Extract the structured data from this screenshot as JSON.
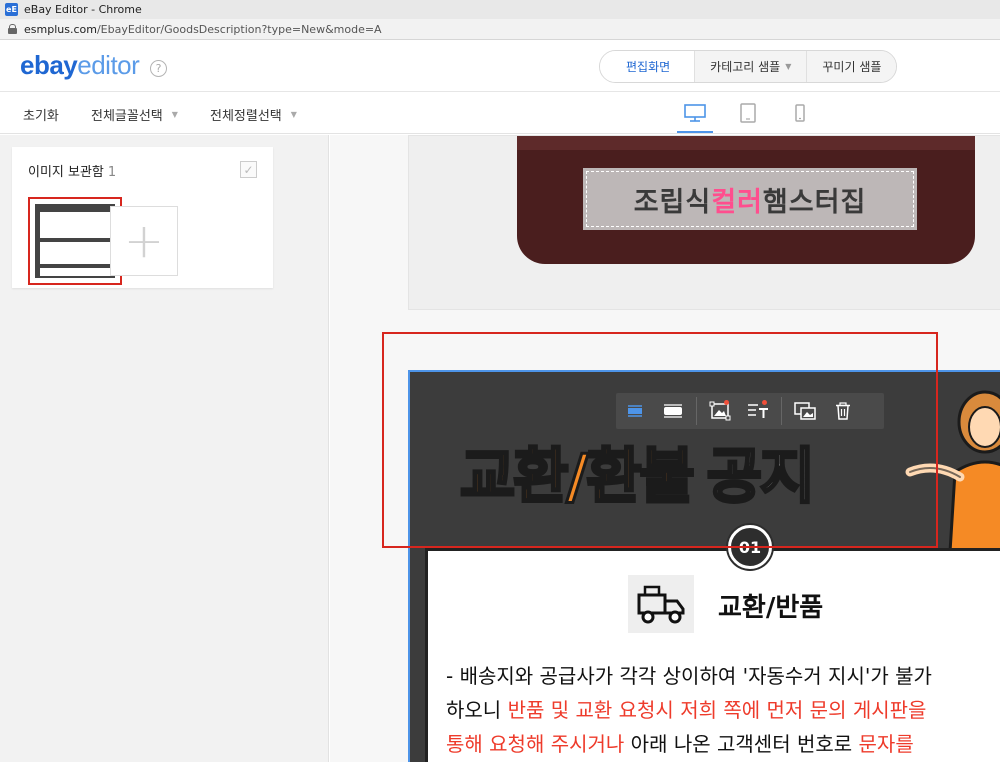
{
  "browser": {
    "window_title": "eBay Editor - Chrome",
    "url_host": "esmplus.com",
    "url_path": "/EbayEditor/GoodsDescription?type=New&mode=A"
  },
  "header": {
    "logo_primary": "ebay",
    "logo_secondary": "editor",
    "help_symbol": "?",
    "tabs": [
      {
        "label": "편집화면",
        "active": true
      },
      {
        "label": "카테고리 샘플",
        "has_dropdown": true
      },
      {
        "label": "꾸미기 샘플"
      }
    ]
  },
  "toolbar": {
    "reset_label": "초기화",
    "font_select_label": "전체글꼴선택",
    "align_select_label": "전체정렬선택",
    "devices": [
      "desktop-icon",
      "tablet-icon",
      "mobile-icon"
    ],
    "active_device": "desktop"
  },
  "sidebar": {
    "storage_title": "이미지 보관함",
    "storage_count": "1",
    "add_symbol": "+"
  },
  "canvas": {
    "banner_text_prefix": "조립식 ",
    "banner_text_highlight": "컬러",
    "banner_text_suffix": " 햄스터집",
    "notice_title_colored": "교환/환불",
    "notice_title_white": "공지",
    "badge_number": "01",
    "card_heading": "교환/반품",
    "card_line1": "- 배송지와 공급사가 각각 상이하여 '자동수거 지시'가 불가",
    "card_line2_plain": "하오니 ",
    "card_line2_red": "반품 및 교환 요청시 저희 쪽에 먼저  문의 게시판을",
    "card_line3_red1": "통해 요청해 주시거나",
    "card_line3_plain": " 아래 나온 고객센터 번호로 ",
    "card_line3_red2": "문자를"
  },
  "floating_toolbar": {
    "buttons": [
      "align-full-icon",
      "align-wide-icon",
      "image-edit-icon",
      "text-edit-icon",
      "image-replace-icon",
      "trash-icon"
    ]
  },
  "colors": {
    "brand_blue": "#1f67d2",
    "accent_orange": "#f58a25",
    "highlight_red": "#ee3b2b",
    "selection_red": "#d7261e",
    "pink": "#ff4e8e"
  }
}
